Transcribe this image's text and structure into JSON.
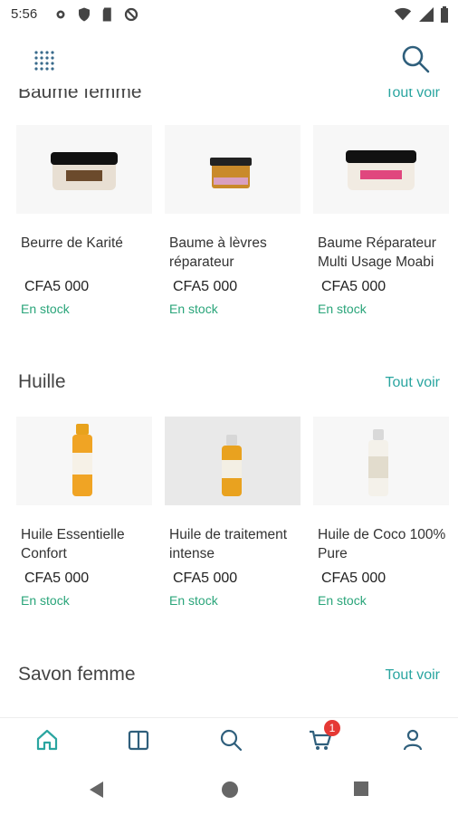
{
  "status_bar": {
    "time": "5:56"
  },
  "sections": [
    {
      "title": "Baume femme",
      "see_all": "Tout voir",
      "products": [
        {
          "name": "Beurre de Karité",
          "price": "CFA5 000",
          "stock": "En stock"
        },
        {
          "name": "Baume à lèvres réparateur",
          "price": "CFA5 000",
          "stock": "En stock"
        },
        {
          "name": "Baume Réparateur Multi Usage Moabi",
          "price": "CFA5 000",
          "stock": "En stock"
        }
      ]
    },
    {
      "title": "Huille",
      "see_all": "Tout voir",
      "products": [
        {
          "name": "Huile Essentielle Confort",
          "price": "CFA5 000",
          "stock": "En stock"
        },
        {
          "name": "Huile de traitement intense",
          "price": "CFA5 000",
          "stock": "En stock"
        },
        {
          "name": "Huile de Coco 100% Pure",
          "price": "CFA5 000",
          "stock": "En stock"
        }
      ]
    },
    {
      "title": "Savon femme",
      "see_all": "Tout voir"
    }
  ],
  "cart": {
    "badge_count": "1"
  },
  "colors": {
    "accent": "#2aa5a0",
    "stock": "#2aa57a",
    "badge": "#e53935"
  },
  "icons": [
    "menu-grid-icon",
    "search-icon",
    "home-icon",
    "catalog-icon",
    "cart-icon",
    "account-icon",
    "back-icon",
    "home-circle-icon",
    "recents-icon"
  ]
}
